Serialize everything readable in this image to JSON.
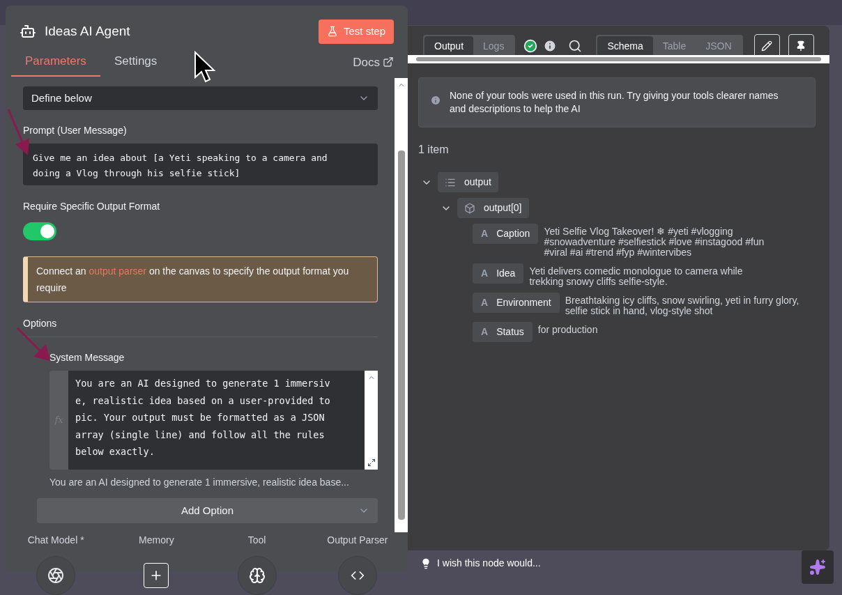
{
  "node": {
    "title": "Ideas AI Agent",
    "test_button": "Test step"
  },
  "tabs": [
    {
      "label": "Parameters",
      "selected": true
    },
    {
      "label": "Settings",
      "selected": false
    }
  ],
  "docs_link": "Docs",
  "prompt_source": {
    "value": "Define below"
  },
  "prompt": {
    "label": "Prompt (User Message)",
    "value": "Give me an idea about [a Yeti speaking to a camera and doing a Vlog through his selfie stick]"
  },
  "output_format": {
    "label": "Require Specific Output Format",
    "on": true
  },
  "notice": {
    "before": "Connect an",
    "link": "output parser",
    "after": "on the canvas to specify the output format you require"
  },
  "options": {
    "heading": "Options",
    "system_message": {
      "label": "System Message",
      "gutter_label": "fx",
      "value": "You are an AI designed to generate 1 immersive, realistic idea based on a user-provided topic. Your output must be formatted as a JSON array (single line) and follow all the rules below exactly.",
      "preview": "You are an AI designed to generate 1 immersive, realistic idea base..."
    },
    "add_button": "Add Option"
  },
  "connections": [
    {
      "label": "Chat Model *",
      "kind": "model"
    },
    {
      "label": "Memory",
      "kind": "add"
    },
    {
      "label": "Tool",
      "kind": "brain"
    },
    {
      "label": "Output Parser",
      "kind": "code"
    }
  ],
  "run_tabs": [
    {
      "label": "Output",
      "selected": true
    },
    {
      "label": "Logs",
      "selected": false
    }
  ],
  "view_tabs": [
    {
      "label": "Schema",
      "selected": true
    },
    {
      "label": "Table",
      "selected": false
    },
    {
      "label": "JSON",
      "selected": false
    }
  ],
  "run_notice": "None of your tools were used in this run. Try giving your tools clearer names and descriptions to help the AI",
  "item_count": "1 item",
  "tree": {
    "key": "output",
    "kind": "list",
    "children": [
      {
        "key": "output[0]",
        "kind": "object",
        "children": [
          {
            "key": "Caption",
            "kind": "string",
            "glyph": "A",
            "value": "Yeti Selfie Vlog Takeover! ❄ #yeti #vlogging #snowadventure #selfiestick #love #instagood #fun #viral #ai #trend #fyp #wintervibes"
          },
          {
            "key": "Idea",
            "kind": "string",
            "glyph": "A",
            "value": "Yeti delivers comedic monologue to camera while trekking snowy cliffs selfie-style."
          },
          {
            "key": "Environment",
            "kind": "string",
            "glyph": "A",
            "value": "Breathtaking icy cliffs, snow swirling, yeti in furry glory, selfie stick in hand, vlog-style shot"
          },
          {
            "key": "Status",
            "kind": "string",
            "glyph": "A",
            "value": "for production"
          }
        ]
      }
    ]
  },
  "feedback": "I wish this node would..."
}
